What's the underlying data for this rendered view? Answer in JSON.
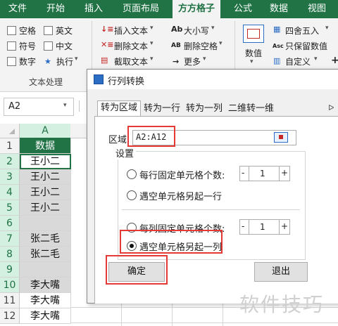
{
  "ribbon": {
    "tabs": [
      "文件",
      "开始",
      "插入",
      "页面布局",
      "方方格子",
      "公式",
      "数据",
      "视图"
    ],
    "text_group": {
      "label": "文本处理",
      "checks": [
        "空格",
        "英文",
        "符号",
        "中文",
        "数字"
      ],
      "execute": "执行"
    },
    "edit": {
      "insert_text": "插入文本",
      "delete_text": "删除文本",
      "extract_text": "截取文本",
      "upper_lower": "大小写",
      "delete_spaces": "删除空格",
      "more": "更多",
      "ab_icon": "Ab",
      "ab2_icon": "AB"
    },
    "numeric": {
      "value_label": "数值",
      "round": "四舍五入",
      "keep_value": "只保留数值",
      "custom": "自定义",
      "asc_icon": "Asc"
    },
    "accent": "#217346"
  },
  "name_box": "A2",
  "sheet": {
    "column": "A",
    "row_numbers": [
      "1",
      "2",
      "3",
      "4",
      "5",
      "6",
      "7",
      "8",
      "9",
      "10",
      "11",
      "12"
    ],
    "cells": [
      "数据",
      "王小二",
      "王小二",
      "王小二",
      "王小二",
      "",
      "张二毛",
      "张二毛",
      "",
      "李大嘴",
      "李大嘴",
      "李大嘴"
    ]
  },
  "dialog": {
    "title": "行列转换",
    "tabs": [
      "转为区域",
      "转为一行",
      "转为一列",
      "二维转一维"
    ],
    "range_label": "区域:",
    "range_value": "A2:A12",
    "settings_label": "设置",
    "options": {
      "row_fixed": "每行固定单元格个数:",
      "row_blank": "遇空单元格另起一行",
      "col_fixed": "每列固定单元格个数:",
      "col_blank": "遇空单元格另起一列"
    },
    "row_fixed_count": "1",
    "col_fixed_count": "1",
    "ok": "确定",
    "exit": "退出"
  },
  "watermark": "软件技巧",
  "highlight_color": "#e53935"
}
